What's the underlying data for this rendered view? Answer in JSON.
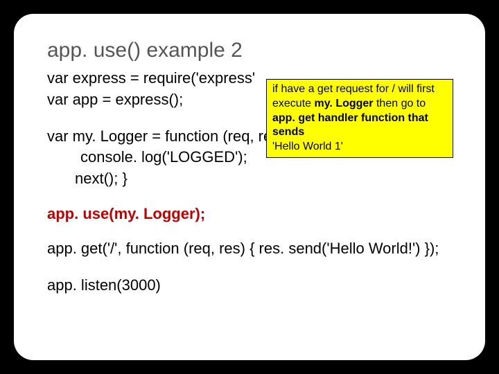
{
  "title": "app. use() example 2",
  "code": {
    "line1": "var express = require('express'",
    "line2": "var app = express();",
    "line3": "var my. Logger = function (req, res, next) {",
    "line4": "console. log('LOGGED');",
    "line5": "next(); }",
    "line6": "app. use(my. Logger);",
    "line7": "app. get('/', function (req, res) { res. send('Hello World!') });",
    "line8": "app. listen(3000)"
  },
  "callout": {
    "part1": " if have a get request for / will first execute ",
    "bold1": "my. Logger",
    "part2": " then go to ",
    "bold2": "app. get handler function that sends",
    "part3": "'Hello World 1'"
  }
}
